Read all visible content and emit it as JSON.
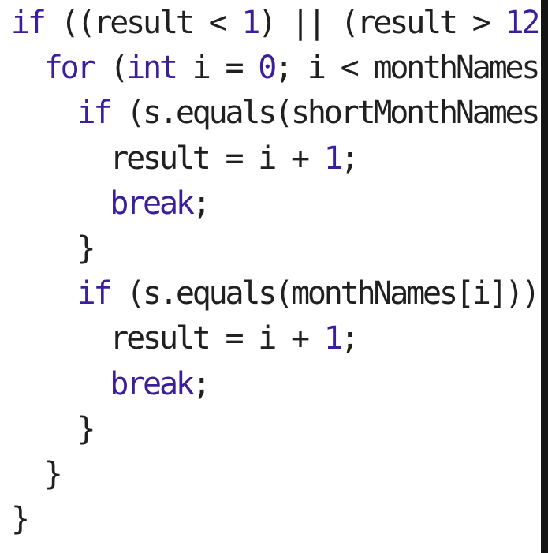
{
  "colors": {
    "background": "#ffffff",
    "text": "#202020",
    "keyword": "#3a1e9c",
    "number": "#3a1e9c",
    "frame": "#0d0d0d"
  },
  "code": {
    "lines": [
      {
        "indent": "",
        "tokens": [
          {
            "text": "if",
            "type": "kw"
          },
          {
            "text": " ((result < ",
            "type": "plain"
          },
          {
            "text": "1",
            "type": "num"
          },
          {
            "text": ") || (result > ",
            "type": "plain"
          },
          {
            "text": "12",
            "type": "num"
          },
          {
            "text": "))",
            "type": "plain"
          }
        ]
      },
      {
        "indent": "  ",
        "tokens": [
          {
            "text": "for",
            "type": "kw"
          },
          {
            "text": " (",
            "type": "plain"
          },
          {
            "text": "int",
            "type": "kw"
          },
          {
            "text": " i = ",
            "type": "plain"
          },
          {
            "text": "0",
            "type": "num"
          },
          {
            "text": "; i < monthNames.le",
            "type": "plain"
          }
        ]
      },
      {
        "indent": "    ",
        "tokens": [
          {
            "text": "if",
            "type": "kw"
          },
          {
            "text": " (s.equals(shortMonthNames[i]",
            "type": "plain"
          }
        ]
      },
      {
        "indent": "      ",
        "tokens": [
          {
            "text": "result = i + ",
            "type": "plain"
          },
          {
            "text": "1",
            "type": "num"
          },
          {
            "text": ";",
            "type": "plain"
          }
        ]
      },
      {
        "indent": "      ",
        "tokens": [
          {
            "text": "break",
            "type": "kw"
          },
          {
            "text": ";",
            "type": "plain"
          }
        ]
      },
      {
        "indent": "    ",
        "tokens": [
          {
            "text": "}",
            "type": "plain"
          }
        ]
      },
      {
        "indent": "    ",
        "tokens": [
          {
            "text": "if",
            "type": "kw"
          },
          {
            "text": " (s.equals(monthNames[i])) {",
            "type": "plain"
          }
        ]
      },
      {
        "indent": "      ",
        "tokens": [
          {
            "text": "result = i + ",
            "type": "plain"
          },
          {
            "text": "1",
            "type": "num"
          },
          {
            "text": ";",
            "type": "plain"
          }
        ]
      },
      {
        "indent": "      ",
        "tokens": [
          {
            "text": "break",
            "type": "kw"
          },
          {
            "text": ";",
            "type": "plain"
          }
        ]
      },
      {
        "indent": "    ",
        "tokens": [
          {
            "text": "}",
            "type": "plain"
          }
        ]
      },
      {
        "indent": "  ",
        "tokens": [
          {
            "text": "}",
            "type": "plain"
          }
        ]
      },
      {
        "indent": "",
        "tokens": [
          {
            "text": "}",
            "type": "plain"
          }
        ]
      }
    ]
  }
}
